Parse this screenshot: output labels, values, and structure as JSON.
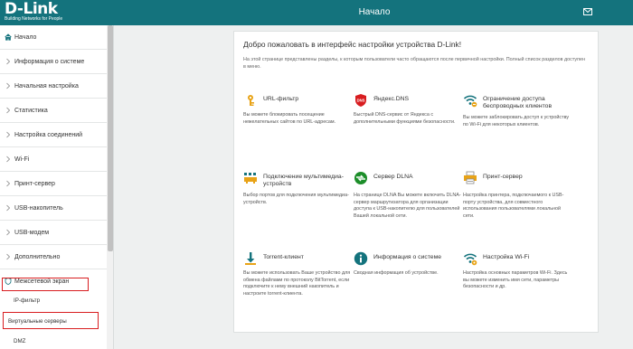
{
  "brand": {
    "logo": "D-Link",
    "tagline": "Building Networks for People"
  },
  "header": {
    "title": "Начало"
  },
  "sidebar": {
    "items": [
      {
        "label": "Начало"
      },
      {
        "label": "Информация о системе"
      },
      {
        "label": "Начальная настройка"
      },
      {
        "label": "Статистика"
      },
      {
        "label": "Настройка соединений"
      },
      {
        "label": "Wi-Fi"
      },
      {
        "label": "Принт-сервер"
      },
      {
        "label": "USB-накопитель"
      },
      {
        "label": "USB-модем"
      },
      {
        "label": "Дополнительно"
      },
      {
        "label": "Межсетевой экран"
      }
    ],
    "subitems": [
      {
        "label": "IP-фильтр"
      },
      {
        "label": "Виртуальные серверы"
      },
      {
        "label": "DMZ"
      }
    ]
  },
  "main": {
    "title": "Добро пожаловать в интерфейс настройки устройства D-Link!",
    "description": "На этой странице представлены разделы, к которым пользователи часто обращаются после первичной настройки. Полный список разделов доступен в меню.",
    "tiles": [
      {
        "name": "URL-фильтр",
        "text": "Вы можете блокировать посещение нежелательных сайтов по URL-адресам.",
        "icon": "url-filter-icon"
      },
      {
        "name": "Яндекс.DNS",
        "text": "Быстрый DNS-сервис от Яндекса с дополнительными функциями безопасности.",
        "icon": "yandex-dns-icon"
      },
      {
        "name": "Ограничение доступа беспроводных клиентов",
        "text": "Вы можете заблокировать доступ к устройству по Wi-Fi для некоторых клиентов.",
        "icon": "wifi-restrict-icon"
      },
      {
        "name": "Подключение мультимедиа-устройств",
        "text": "Выбор портов для подключения мультимедиа-устройств.",
        "icon": "multimedia-icon"
      },
      {
        "name": "Сервер DLNA",
        "text": "На странице DLNA Вы можете включить DLNA-сервер маршрутизатора для организации доступа к USB-накопителю для пользователей Вашей локальной сети.",
        "icon": "dlna-icon"
      },
      {
        "name": "Принт-сервер",
        "text": "Настройка принтера, подключаемого к USB-порту устройства, для совместного использования пользователями локальной сети.",
        "icon": "printer-icon"
      },
      {
        "name": "Torrent-клиент",
        "text": "Вы можете использовать Ваше устройство для обмена файлами по протоколу BitTorrent, если подключите к нему внешний накопитель и настроите torrent-клиента.",
        "icon": "torrent-icon"
      },
      {
        "name": "Информация о системе",
        "text": "Сводная информация об устройстве.",
        "icon": "info-icon"
      },
      {
        "name": "Настройка Wi-Fi",
        "text": "Настройка основных параметров Wi-Fi. Здесь вы можете изменить имя сети, параметры безопасности и др.",
        "icon": "wifi-icon"
      }
    ]
  },
  "colors": {
    "header": "#14737d",
    "accent": "#14737d",
    "highlight": "#d81d20"
  }
}
